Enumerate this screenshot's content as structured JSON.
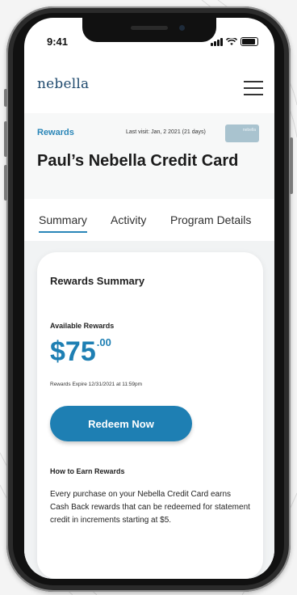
{
  "status_bar": {
    "time": "9:41"
  },
  "header": {
    "logo": "nebella"
  },
  "banner": {
    "section_label": "Rewards",
    "last_visit": "Last visit: Jan, 2 2021 (21 days)",
    "card_brand": "nebella",
    "title": "Paul’s Nebella Credit Card"
  },
  "tabs": [
    {
      "label": "Summary",
      "active": true
    },
    {
      "label": "Activity",
      "active": false
    },
    {
      "label": "Program Details",
      "active": false
    }
  ],
  "summary": {
    "title": "Rewards Summary",
    "available_label": "Available Rewards",
    "amount_dollars": "$75",
    "amount_cents": ".00",
    "expires": "Rewards Expire 12/31/2021 at 11:59pm",
    "redeem_label": "Redeem Now",
    "how_title": "How to Earn Rewards",
    "how_body": "Every purchase on your Nebella Credit Card earns Cash Back rewards that can be redeemed for statement credit in increments starting at $5."
  },
  "colors": {
    "accent": "#1e7fb3",
    "label_blue": "#2a86b8"
  }
}
